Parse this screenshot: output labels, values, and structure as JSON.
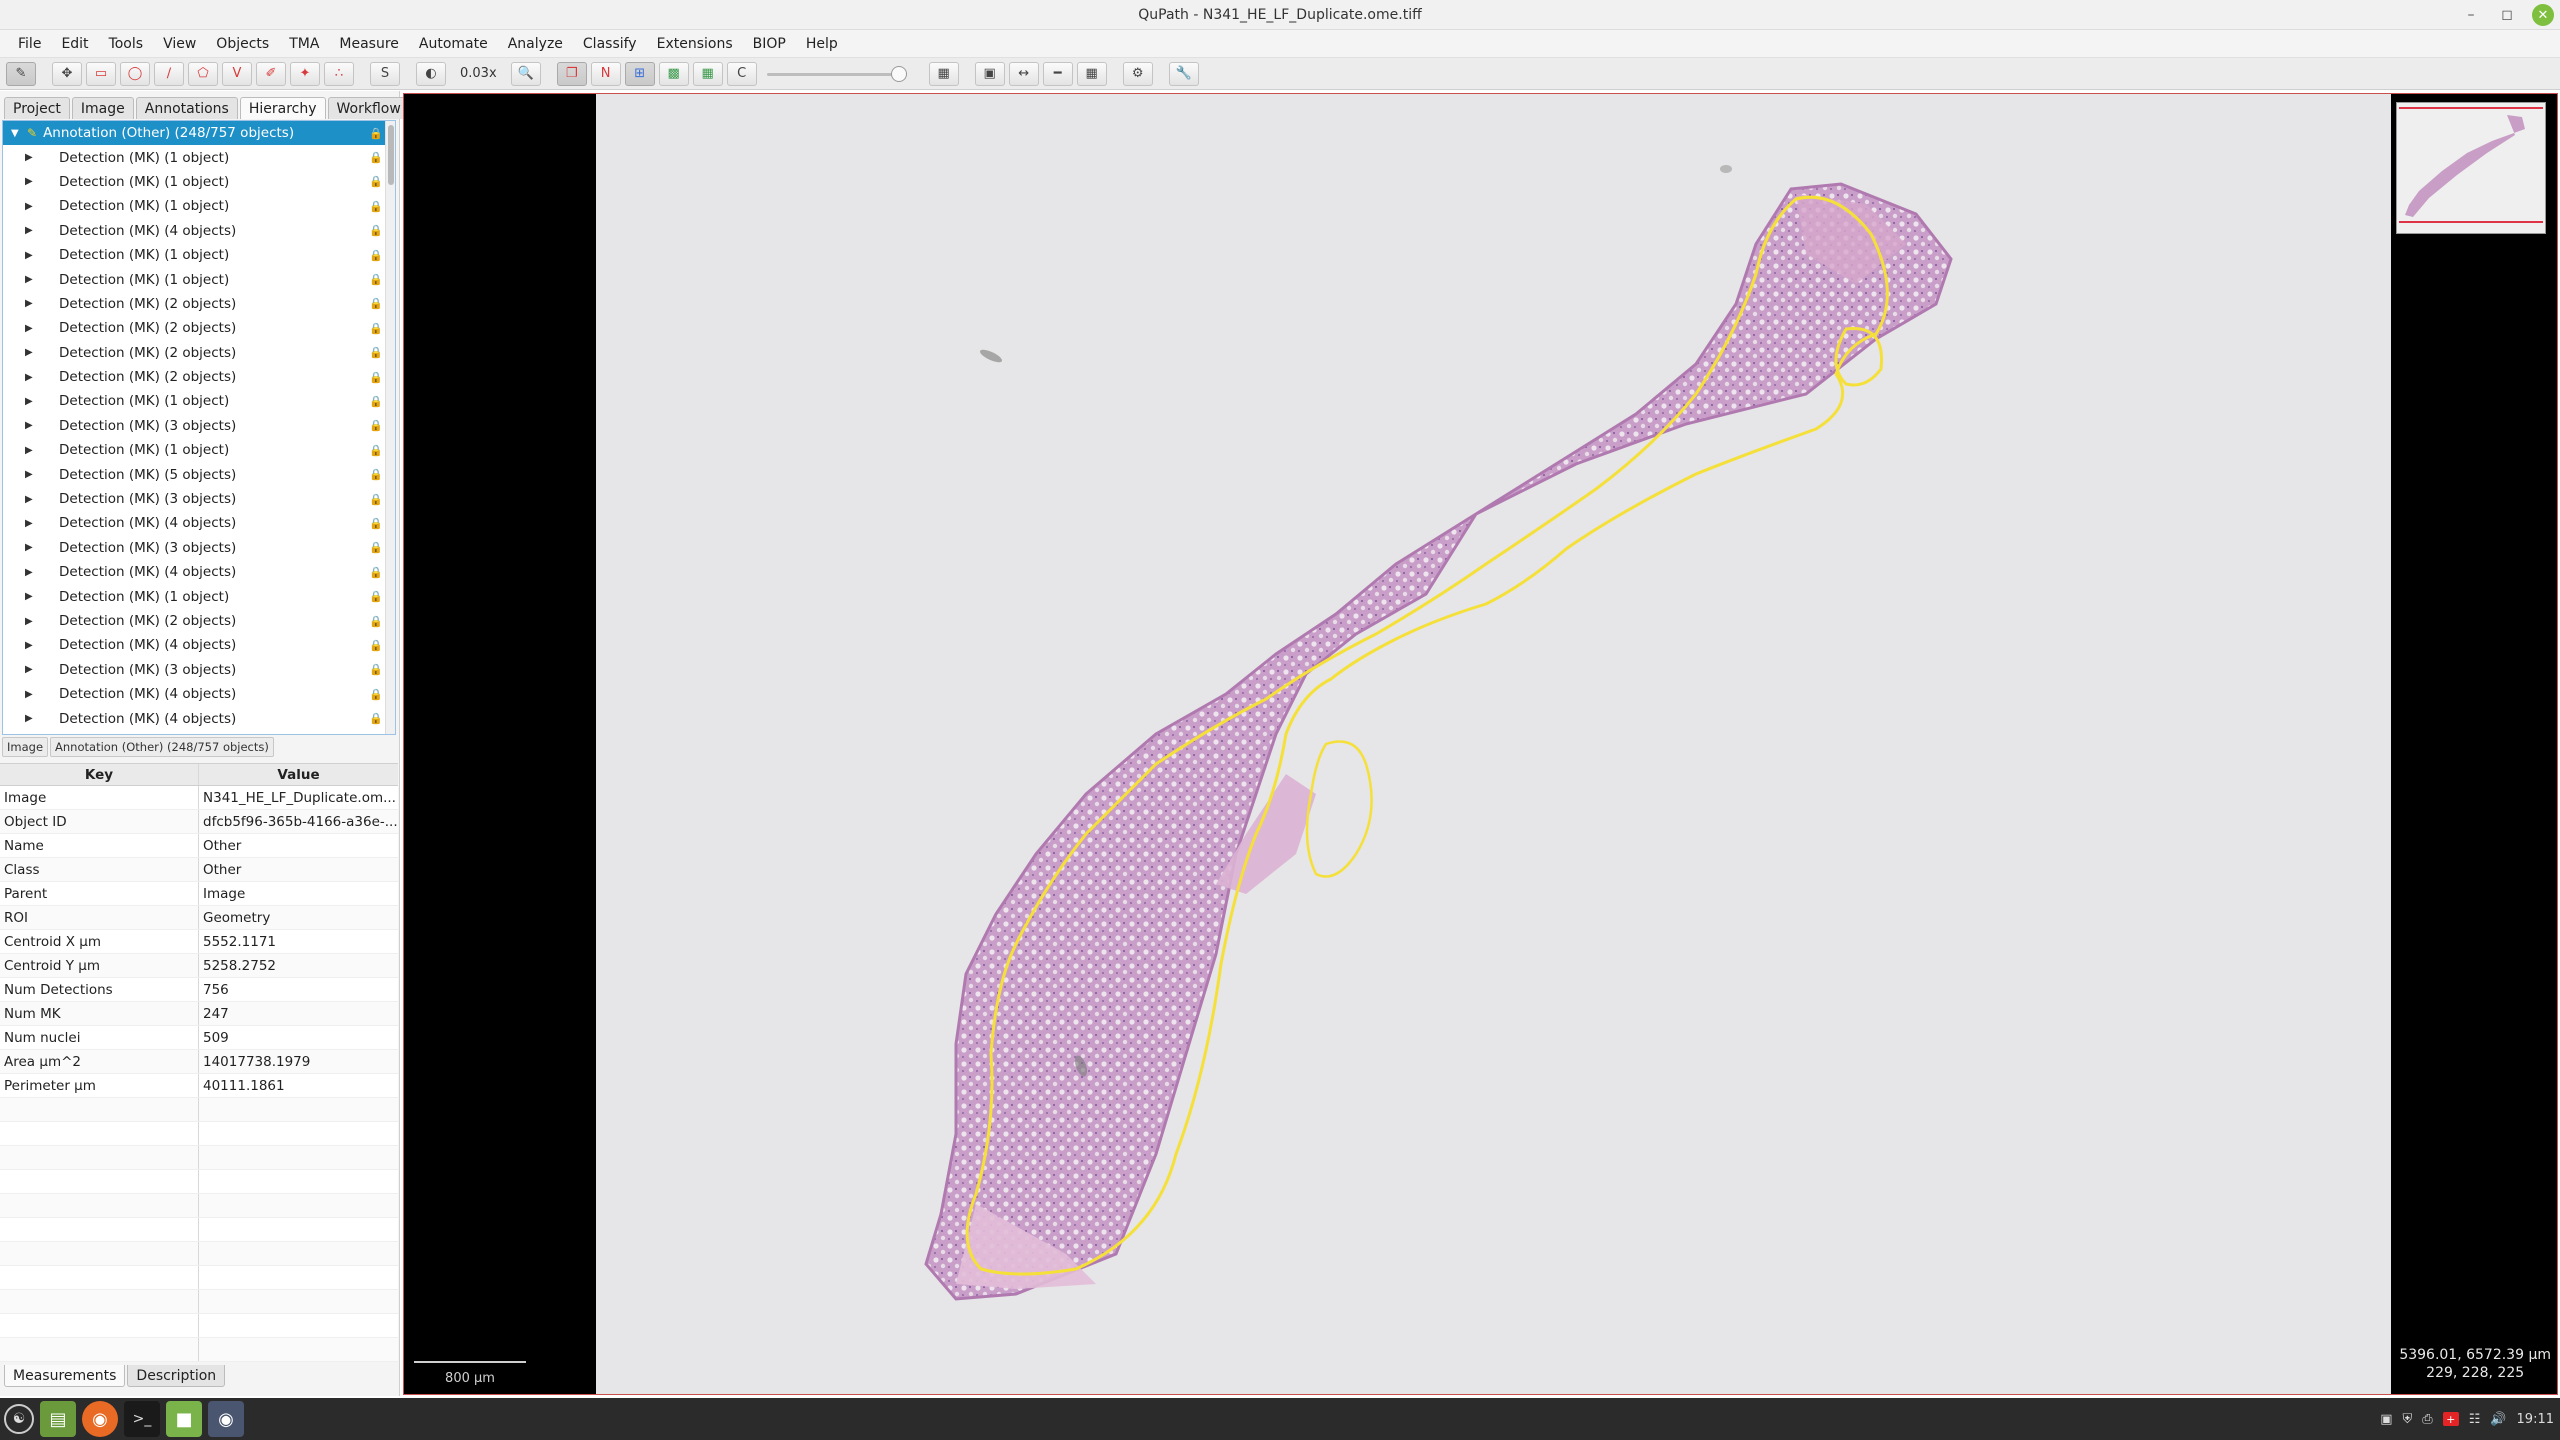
{
  "window": {
    "title": "QuPath - N341_HE_LF_Duplicate.ome.tiff",
    "controls": [
      "minimize-icon",
      "maximize-icon",
      "close-icon"
    ]
  },
  "menubar": {
    "items": [
      "File",
      "Edit",
      "Tools",
      "View",
      "Objects",
      "TMA",
      "Measure",
      "Automate",
      "Analyze",
      "Classify",
      "Extensions",
      "BIOP",
      "Help"
    ]
  },
  "toolbar": {
    "s_label": "S",
    "zoom": "0.03x",
    "n_label": "N",
    "c_label": "C"
  },
  "left_tabs": [
    "Project",
    "Image",
    "Annotations",
    "Hierarchy",
    "Workflow"
  ],
  "left_tabs_active": "Hierarchy",
  "hierarchy": {
    "root": "Annotation (Other) (248/757 objects)",
    "items": [
      "Detection (MK) (1 object)",
      "Detection (MK) (1 object)",
      "Detection (MK) (1 object)",
      "Detection (MK) (4 objects)",
      "Detection (MK) (1 object)",
      "Detection (MK) (1 object)",
      "Detection (MK) (2 objects)",
      "Detection (MK) (2 objects)",
      "Detection (MK) (2 objects)",
      "Detection (MK) (2 objects)",
      "Detection (MK) (1 object)",
      "Detection (MK) (3 objects)",
      "Detection (MK) (1 object)",
      "Detection (MK) (5 objects)",
      "Detection (MK) (3 objects)",
      "Detection (MK) (4 objects)",
      "Detection (MK) (3 objects)",
      "Detection (MK) (4 objects)",
      "Detection (MK) (1 object)",
      "Detection (MK) (2 objects)",
      "Detection (MK) (4 objects)",
      "Detection (MK) (3 objects)",
      "Detection (MK) (4 objects)",
      "Detection (MK) (4 objects)"
    ]
  },
  "breadcrumb": [
    "Image",
    "Annotation (Other) (248/757 objects)"
  ],
  "properties": {
    "header_key": "Key",
    "header_value": "Value",
    "rows": [
      {
        "key": "Image",
        "value": "N341_HE_LF_Duplicate.om..."
      },
      {
        "key": "Object ID",
        "value": "dfcb5f96-365b-4166-a36e-..."
      },
      {
        "key": "Name",
        "value": "Other"
      },
      {
        "key": "Class",
        "value": "Other"
      },
      {
        "key": "Parent",
        "value": "Image"
      },
      {
        "key": "ROI",
        "value": "Geometry"
      },
      {
        "key": "Centroid X µm",
        "value": "5552.1171"
      },
      {
        "key": "Centroid Y µm",
        "value": "5258.2752"
      },
      {
        "key": "Num Detections",
        "value": "756"
      },
      {
        "key": "Num MK",
        "value": "247"
      },
      {
        "key": "Num nuclei",
        "value": "509"
      },
      {
        "key": "Area µm^2",
        "value": "14017738.1979"
      },
      {
        "key": "Perimeter µm",
        "value": "40111.1861"
      }
    ]
  },
  "bottom_tabs": [
    "Measurements",
    "Description"
  ],
  "viewer": {
    "scalebar": "800 µm",
    "cursor_coords": "5396.01, 6572.39 µm",
    "cursor_rgb": "229, 228, 225",
    "annotation_color": "#f5e03a",
    "tissue_color": "#c48fc0"
  },
  "taskbar": {
    "clock": "19:11",
    "apps": [
      "mint-menu-icon",
      "files-icon",
      "firefox-icon",
      "terminal-icon",
      "folder-icon",
      "qupath-icon"
    ]
  }
}
